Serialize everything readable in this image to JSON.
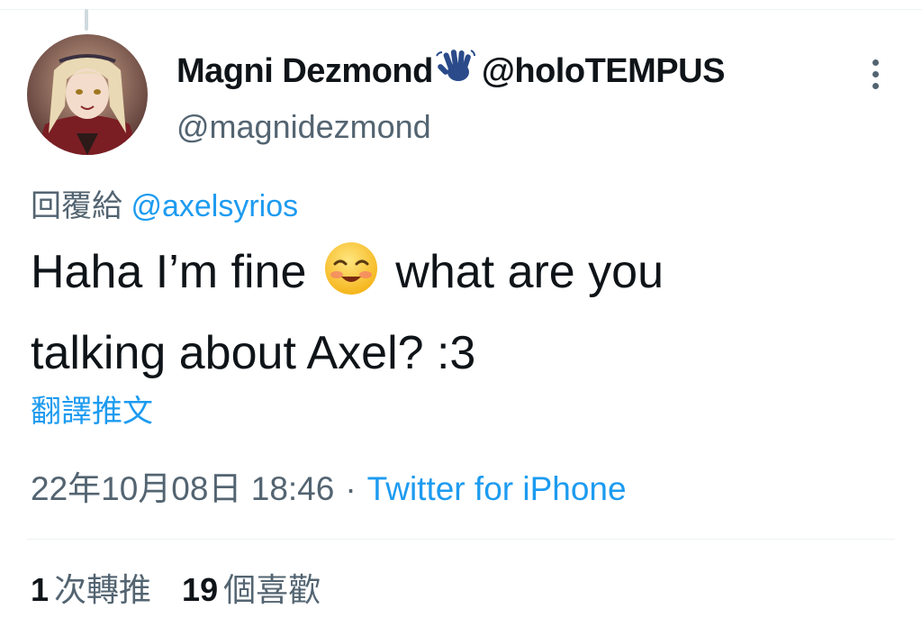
{
  "author": {
    "display_name": "Magni Dezmond",
    "name_suffix": "@holoTEMPUS",
    "handle": "@magnidezmond",
    "avatar_icon": "avatar-image",
    "name_icon": "waving-hand-icon"
  },
  "reply": {
    "prefix": "回覆給",
    "mention": "@axelsyrios"
  },
  "tweet": {
    "text_line1_a": "Haha I’m fine",
    "emoji_icon": "smiling-face-icon",
    "text_line1_b": "what are you",
    "text_line2": "talking about Axel? :3",
    "translate_label": "翻譯推文"
  },
  "meta": {
    "timestamp": "22年10月08日 18:46",
    "separator": "·",
    "source": "Twitter for iPhone"
  },
  "stats": {
    "retweets_count": "1",
    "retweets_label": "次轉推",
    "likes_count": "19",
    "likes_label": "個喜歡"
  },
  "colors": {
    "link": "#1d9bf0",
    "secondary_text": "#536471",
    "primary_text": "#0f1419"
  }
}
